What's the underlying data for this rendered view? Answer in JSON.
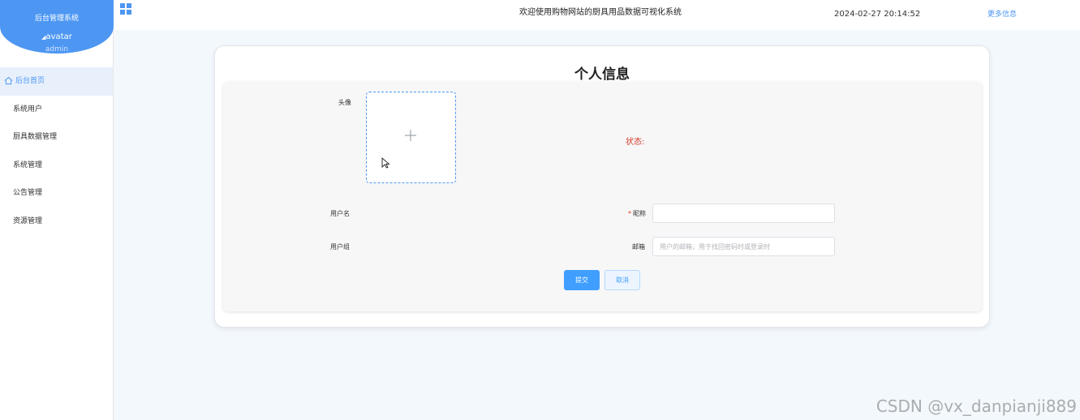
{
  "sidebar": {
    "system_title": "后台管理系统",
    "avatar_alt": "avatar",
    "username": "admin",
    "items": [
      {
        "label": "后台首页"
      },
      {
        "label": "系统用户"
      },
      {
        "label": "厨具数据管理"
      },
      {
        "label": "系统管理"
      },
      {
        "label": "公告管理"
      },
      {
        "label": "资源管理"
      }
    ]
  },
  "header": {
    "title": "欢迎使用购物网站的厨具用品数据可视化系统",
    "datetime": "2024-02-27 20:14:52",
    "more": "更多信息"
  },
  "card": {
    "title": "个人信息",
    "form": {
      "avatar_label": "头像",
      "status_label": "状态:",
      "username_label": "用户名",
      "nickname_label": "昵称",
      "nickname_value": "",
      "group_label": "用户组",
      "email_label": "邮箱",
      "email_placeholder": "用户的邮箱，用于找回密码时或登录时",
      "submit": "提交",
      "cancel": "取消"
    }
  },
  "watermark": "CSDN @vx_danpianji889",
  "colors": {
    "accent": "#409eff",
    "sidebar_header": "#4d97f3",
    "status": "#d43a2a"
  }
}
